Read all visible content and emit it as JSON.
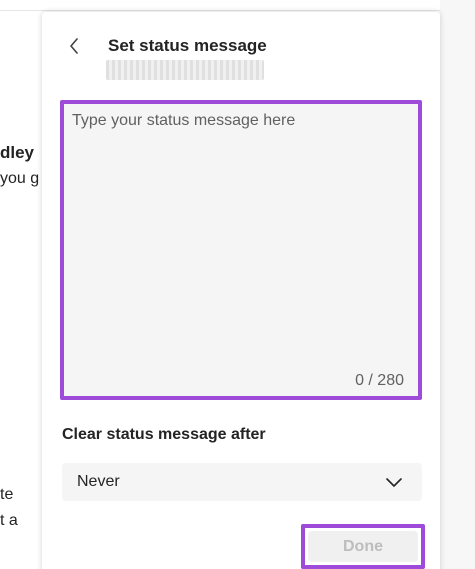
{
  "background": {
    "name_fragment": "dley",
    "text_line_1": "you g",
    "text_line_2": "te",
    "text_line_3": "t a"
  },
  "panel": {
    "title": "Set status message",
    "back_icon": "chevron-left-icon",
    "message": {
      "value": "",
      "placeholder": "Type your status message here",
      "counter": "0 / 280"
    },
    "clear_after": {
      "label": "Clear status message after",
      "selected": "Never",
      "icon": "chevron-down-icon"
    },
    "done_label": "Done"
  },
  "colors": {
    "highlight": "#9d4bd8",
    "input_bg": "#f5f5f5",
    "disabled_text": "#bdbdbd"
  }
}
